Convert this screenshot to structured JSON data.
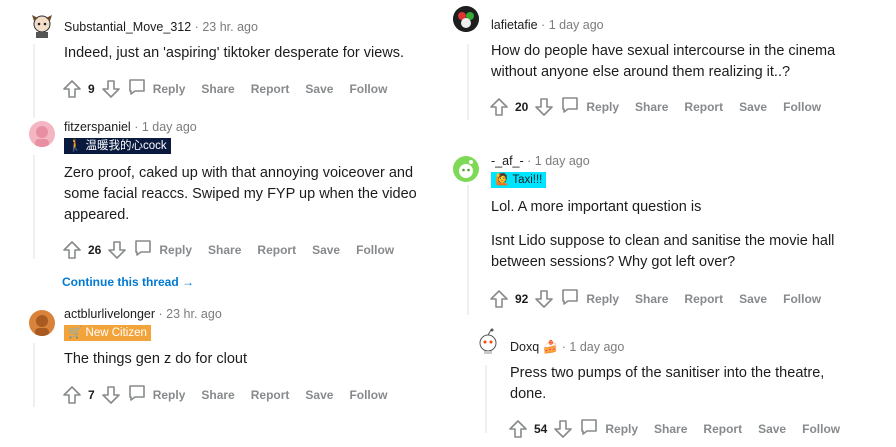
{
  "actions": {
    "reply": "Reply",
    "share": "Share",
    "report": "Report",
    "save": "Save",
    "follow": "Follow"
  },
  "left": {
    "comments": [
      {
        "user": "Substantial_Move_312",
        "sep": "·",
        "time": "23 hr. ago",
        "flair": "",
        "body": [
          "Indeed, just an 'aspiring' tiktoker desperate for views."
        ],
        "score": "9"
      },
      {
        "user": "fitzerspaniel",
        "sep": "·",
        "time": "1 day ago",
        "flair": "温暖我的心cock",
        "body": [
          "Zero proof, caked up with that annoying voiceover and",
          "some facial reaccs. Swiped my FYP up when the video",
          "appeared."
        ],
        "score": "26"
      },
      {
        "user": "actblurlivelonger",
        "sep": "·",
        "time": "23 hr. ago",
        "flair": "New Citizen",
        "body": [
          "The things gen z do for clout"
        ],
        "score": "7"
      }
    ],
    "continue_thread": "Continue this thread"
  },
  "right": {
    "comments": [
      {
        "user": "lafietafie",
        "sep": "·",
        "time": "1 day ago",
        "flair": "",
        "body": [
          "How do people have sexual intercourse in the cinema",
          "without anyone else around them realizing it..?"
        ],
        "score": "20"
      },
      {
        "user": "-_af_-",
        "sep": "·",
        "time": "1 day ago",
        "flair": "Taxi!!!",
        "body": [
          "Lol. A more important question is",
          "",
          "Isnt Lido suppose to clean and sanitise the movie hall",
          "between sessions? Why got left over?"
        ],
        "score": "92"
      },
      {
        "user": "Doxq",
        "sep": "·",
        "time": "1 day ago",
        "flair": "",
        "body": [
          "Press two pumps of the sanitiser into the theatre,",
          "done."
        ],
        "score": "54"
      }
    ]
  },
  "colors": {
    "meta_grey": "#7c7c7c",
    "action_grey": "#878a8c",
    "link_blue": "#0079d3",
    "flair_dark": "#0a1a3f",
    "flair_orange": "#f2a33a",
    "flair_cyan": "#00e5ff",
    "thread_line": "#edeff1"
  }
}
